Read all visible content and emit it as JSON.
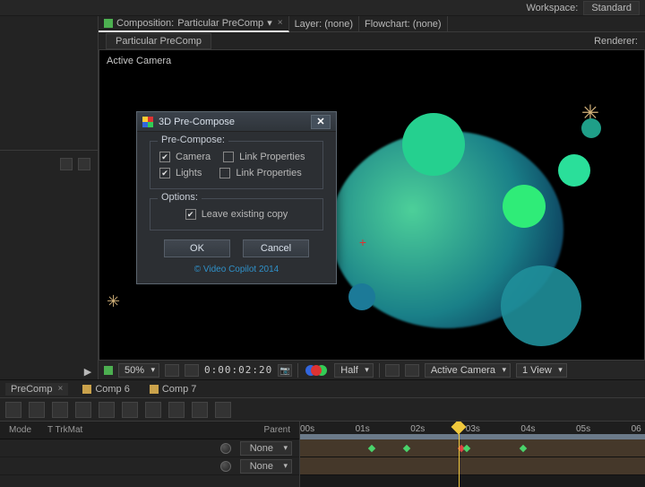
{
  "workspace": {
    "label": "Workspace:",
    "value": "Standard"
  },
  "header": {
    "comp_prefix": "Composition:",
    "comp_name": "Particular PreComp",
    "layer_tab": "Layer: (none)",
    "flowchart_tab": "Flowchart: (none)",
    "sub_tab": "Particular PreComp",
    "renderer_label": "Renderer:"
  },
  "viewer": {
    "active_camera": "Active Camera",
    "zoom": "50%",
    "timecode": "0:00:02:20",
    "channel": "Half",
    "view_menu": "Active Camera",
    "view_count": "1 View"
  },
  "timeline": {
    "tabs": [
      {
        "label": "PreComp",
        "active": true
      },
      {
        "label": "Comp 6",
        "active": false
      },
      {
        "label": "Comp 7",
        "active": false
      }
    ],
    "columns": {
      "mode": "Mode",
      "trkmat": "T   TrkMat",
      "parent": "Parent"
    },
    "parent_value": "None",
    "ruler": [
      "00s",
      "01s",
      "02s",
      "03s",
      "04s",
      "05s",
      "06"
    ],
    "cti_pos_pct": 46
  },
  "dialog": {
    "title": "3D Pre-Compose",
    "group1_legend": "Pre-Compose:",
    "camera_label": "Camera",
    "camera_checked": true,
    "camera_link_label": "Link Properties",
    "camera_link_checked": false,
    "lights_label": "Lights",
    "lights_checked": true,
    "lights_link_label": "Link Properties",
    "lights_link_checked": false,
    "group2_legend": "Options:",
    "leave_copy_label": "Leave existing copy",
    "leave_copy_checked": true,
    "ok": "OK",
    "cancel": "Cancel",
    "copyright": "© Video Copilot 2014"
  }
}
